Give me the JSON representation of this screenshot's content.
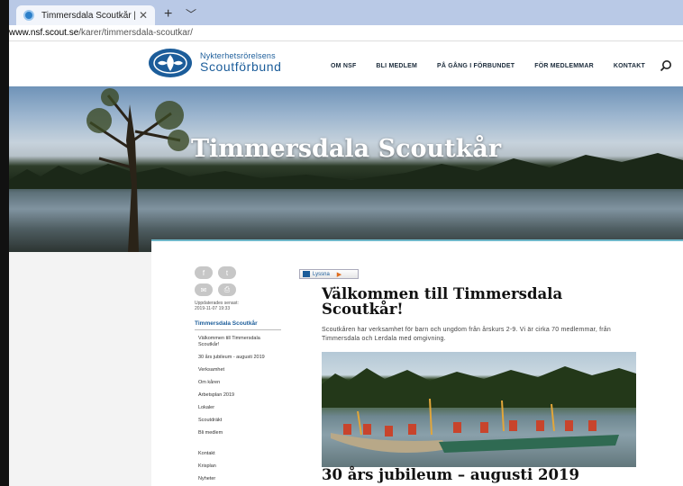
{
  "browser": {
    "tab_title": "Timmersdala Scoutkår |",
    "tab_close": "✕",
    "new_tab": "+",
    "tab_menu": "﹀",
    "url_domain": "www.nsf.scout.se",
    "url_path": "/karer/timmersdala-scoutkar/"
  },
  "header": {
    "logo_line1": "Nykterhetsrörelsens",
    "logo_line2": "Scoutförbund",
    "nav": [
      {
        "label": "OM NSF"
      },
      {
        "label": "BLI MEDLEM"
      },
      {
        "label": "PÅ GÅNG I FÖRBUNDET"
      },
      {
        "label": "FÖR MEDLEMMAR"
      },
      {
        "label": "KONTAKT"
      }
    ]
  },
  "hero": {
    "title": "Timmersdala Scoutkår"
  },
  "sidebar": {
    "share": [
      {
        "icon": "facebook-icon",
        "glyph": "f"
      },
      {
        "icon": "twitter-icon",
        "glyph": "t"
      },
      {
        "icon": "mail-icon",
        "glyph": "✉"
      },
      {
        "icon": "print-icon",
        "glyph": "⎙"
      }
    ],
    "updated_label": "Uppdaterades senast:",
    "updated_value": "2019-11-07 19:33",
    "nav_title": "Timmersdala Scoutkår",
    "nav_items": [
      "Välkommen till Timmersdala Scoutkår!",
      "30 års jubileum - augusti 2019",
      "Verksamhet",
      "Om kåren",
      "Arbetsplan 2019",
      "Lokaler",
      "Scoutdräkt",
      "Bli medlem"
    ],
    "nav_items_extra": [
      "Kontakt",
      "Krisplan",
      "Nyheter"
    ]
  },
  "article": {
    "listen_label": "Lyssna",
    "title": "Välkommen till Timmersdala Scoutkår!",
    "intro": "Scoutkåren har verksamhet för barn och ungdom från årskurs 2-9. Vi är cirka 70 medlemmar, från Timmersdala och Lerdala med omgivning.",
    "section_title": "30 års jubileum – augusti 2019"
  },
  "colors": {
    "brand_blue": "#1c5d9a",
    "accent_teal": "#6fb7c9"
  }
}
